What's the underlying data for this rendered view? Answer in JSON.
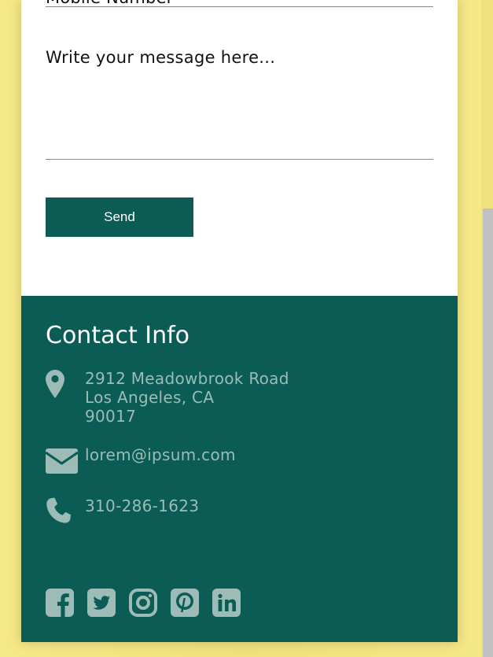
{
  "form": {
    "mobile_label": "Mobile Number",
    "message_placeholder": "Write your message here...",
    "send_label": "Send"
  },
  "contact": {
    "title": "Contact Info",
    "address_line1": "2912 Meadowbrook Road",
    "address_line2": "Los Angeles, CA",
    "address_line3": "90017",
    "email": "lorem@ipsum.com",
    "phone": "310-286-1623"
  },
  "icons": {
    "address": "map-pin-icon",
    "email": "envelope-icon",
    "phone": "phone-icon",
    "social": [
      "facebook-icon",
      "twitter-icon",
      "instagram-icon",
      "pinterest-icon",
      "linkedin-icon"
    ]
  },
  "colors": {
    "page_background": "#f3e68a",
    "brand_green": "#0a5c55",
    "muted_text": "#9dbbb7",
    "white": "#ffffff"
  }
}
